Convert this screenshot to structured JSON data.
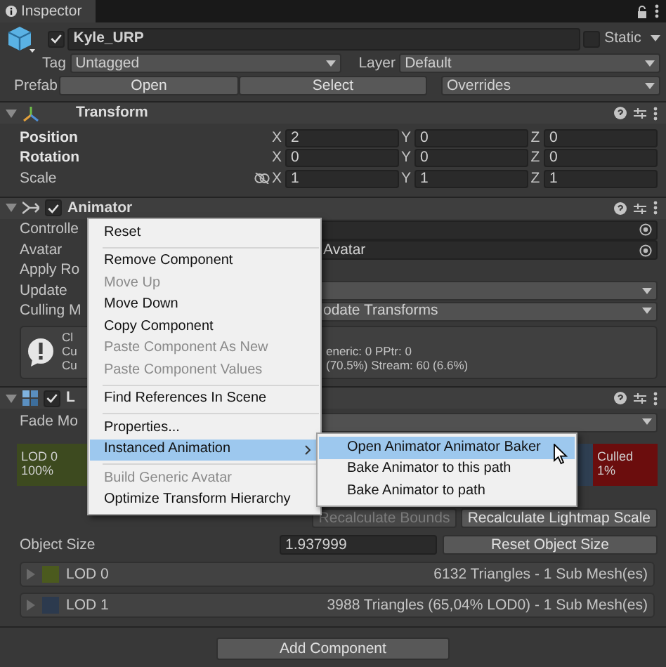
{
  "tab": {
    "label": "Inspector"
  },
  "object": {
    "active": true,
    "name": "Kyle_URP",
    "static": false,
    "static_label": "Static",
    "tag_label": "Tag",
    "tag": "Untagged",
    "layer_label": "Layer",
    "layer": "Default",
    "prefab_label": "Prefab",
    "prefab_buttons": [
      "Open",
      "Select"
    ],
    "overrides": "Overrides"
  },
  "transform": {
    "title": "Transform",
    "expanded": true,
    "rows": [
      {
        "label": "Position",
        "overridden": true,
        "proportional_icon": false,
        "fields": [
          {
            "axis": "X",
            "value": "2"
          },
          {
            "axis": "Y",
            "value": "0"
          },
          {
            "axis": "Z",
            "value": "0"
          }
        ]
      },
      {
        "label": "Rotation",
        "overridden": true,
        "proportional_icon": false,
        "fields": [
          {
            "axis": "X",
            "value": "0"
          },
          {
            "axis": "Y",
            "value": "0"
          },
          {
            "axis": "Z",
            "value": "0"
          }
        ]
      },
      {
        "label": "Scale",
        "overridden": false,
        "proportional_icon": true,
        "fields": [
          {
            "axis": "X",
            "value": "1"
          },
          {
            "axis": "Y",
            "value": "1"
          },
          {
            "axis": "Z",
            "value": "1"
          }
        ]
      }
    ]
  },
  "animator": {
    "title": "Animator",
    "expanded": true,
    "enabled": true,
    "rows": [
      {
        "label": "Controlle",
        "kind": "object",
        "value": ""
      },
      {
        "label": "Avatar",
        "kind": "object",
        "value": "Avatar"
      },
      {
        "label": "Apply Ro",
        "kind": "none"
      },
      {
        "label": "Update",
        "kind": "dropdown",
        "value": ""
      },
      {
        "label": "Culling M",
        "kind": "dropdown",
        "value": "odate Transforms"
      }
    ],
    "info": {
      "left_lines": [
        "Cl",
        "Cu",
        "Cu"
      ],
      "right_lines": [
        "eneric: 0 PPtr: 0",
        "(70.5%) Stream: 60 (6.6%)"
      ]
    }
  },
  "lod_group": {
    "title": "L",
    "expanded": true,
    "enabled": true,
    "fade_label": "Fade Mo",
    "segments": [
      {
        "label": "LOD 0",
        "value": "100%",
        "color": "#3d4a1f"
      },
      {
        "color": "#2f3f52"
      },
      {
        "label": "Culled",
        "value": "1%",
        "color": "#6b0d0d"
      }
    ],
    "buttons": [
      {
        "label": "Recalculate Bounds",
        "disabled": true
      },
      {
        "label": "Recalculate Lightmap Scale",
        "disabled": false
      }
    ],
    "object_size_label": "Object Size",
    "object_size": "1.937999",
    "reset_label": "Reset Object Size",
    "lods": [
      {
        "label": "LOD 0",
        "color": "#4b5a1e",
        "info": "6132 Triangles  - 1 Sub Mesh(es)"
      },
      {
        "label": "LOD 1",
        "color": "#2c3a4e",
        "info": "3988 Triangles (65,04% LOD0) - 1 Sub Mesh(es)"
      }
    ]
  },
  "add_component": "Add Component",
  "context_menu": {
    "items": [
      {
        "kind": "item",
        "label": "Reset",
        "disabled": false,
        "selected": false,
        "has_submenu": false
      },
      {
        "kind": "separator"
      },
      {
        "kind": "item",
        "label": "Remove Component",
        "disabled": false,
        "selected": false,
        "has_submenu": false
      },
      {
        "kind": "item",
        "label": "Move Up",
        "disabled": true,
        "selected": false,
        "has_submenu": false
      },
      {
        "kind": "item",
        "label": "Move Down",
        "disabled": false,
        "selected": false,
        "has_submenu": false
      },
      {
        "kind": "item",
        "label": "Copy Component",
        "disabled": false,
        "selected": false,
        "has_submenu": false
      },
      {
        "kind": "item",
        "label": "Paste Component As New",
        "disabled": true,
        "selected": false,
        "has_submenu": false
      },
      {
        "kind": "item",
        "label": "Paste Component Values",
        "disabled": true,
        "selected": false,
        "has_submenu": false
      },
      {
        "kind": "separator"
      },
      {
        "kind": "item",
        "label": "Find References In Scene",
        "disabled": false,
        "selected": false,
        "has_submenu": false
      },
      {
        "kind": "separator"
      },
      {
        "kind": "item",
        "label": "Properties...",
        "disabled": false,
        "selected": false,
        "has_submenu": false
      },
      {
        "kind": "item",
        "label": "Instanced Animation",
        "disabled": false,
        "selected": true,
        "has_submenu": true
      },
      {
        "kind": "separator"
      },
      {
        "kind": "item",
        "label": "Build Generic Avatar",
        "disabled": true,
        "selected": false,
        "has_submenu": false
      },
      {
        "kind": "item",
        "label": "Optimize Transform Hierarchy",
        "disabled": false,
        "selected": false,
        "has_submenu": false
      }
    ]
  },
  "submenu": {
    "items": [
      {
        "label": "Open Animator Animator Baker",
        "selected": true
      },
      {
        "label": "Bake Animator to this path",
        "selected": false
      },
      {
        "label": "Bake Animator to path",
        "selected": false
      }
    ]
  }
}
